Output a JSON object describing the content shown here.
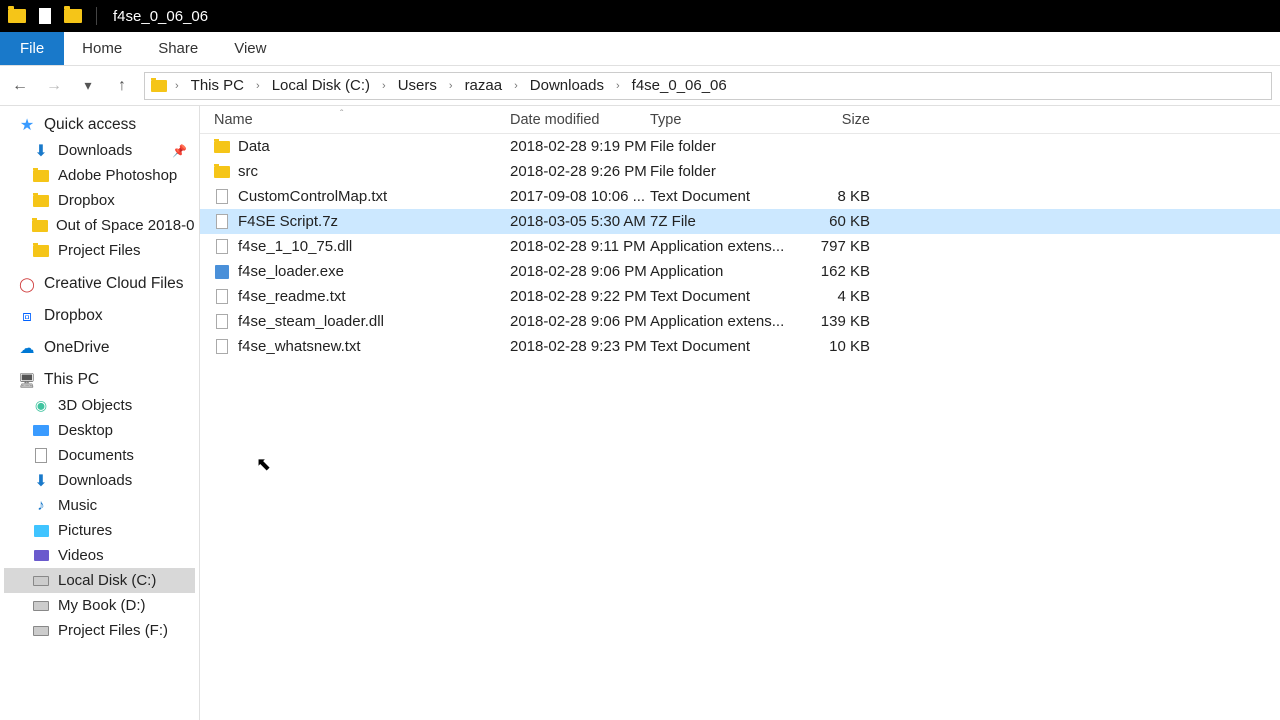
{
  "window": {
    "title": "f4se_0_06_06"
  },
  "ribbon": {
    "file": "File",
    "tabs": [
      "Home",
      "Share",
      "View"
    ]
  },
  "breadcrumb": [
    "This PC",
    "Local Disk (C:)",
    "Users",
    "razaa",
    "Downloads",
    "f4se_0_06_06"
  ],
  "columns": {
    "name": "Name",
    "date": "Date modified",
    "type": "Type",
    "size": "Size"
  },
  "sidebar": {
    "quick_access": {
      "label": "Quick access"
    },
    "quick_items": [
      {
        "label": "Downloads",
        "icon": "down",
        "pinned": true
      },
      {
        "label": "Adobe Photoshop",
        "icon": "folder"
      },
      {
        "label": "Dropbox",
        "icon": "folder"
      },
      {
        "label": "Out of Space 2018-0",
        "icon": "folder"
      },
      {
        "label": "Project Files",
        "icon": "folder"
      }
    ],
    "roots": [
      {
        "label": "Creative Cloud Files",
        "icon": "cc"
      },
      {
        "label": "Dropbox",
        "icon": "dropbox"
      },
      {
        "label": "OneDrive",
        "icon": "onedrive"
      },
      {
        "label": "This PC",
        "icon": "pc"
      }
    ],
    "thispc": [
      {
        "label": "3D Objects",
        "icon": "3d"
      },
      {
        "label": "Desktop",
        "icon": "desktop"
      },
      {
        "label": "Documents",
        "icon": "doc"
      },
      {
        "label": "Downloads",
        "icon": "down"
      },
      {
        "label": "Music",
        "icon": "music"
      },
      {
        "label": "Pictures",
        "icon": "pic"
      },
      {
        "label": "Videos",
        "icon": "vid"
      },
      {
        "label": "Local Disk (C:)",
        "icon": "disk",
        "selected": true
      },
      {
        "label": "My Book (D:)",
        "icon": "disk"
      },
      {
        "label": "Project Files (F:)",
        "icon": "disk"
      }
    ]
  },
  "files": [
    {
      "name": "Data",
      "date": "2018-02-28 9:19 PM",
      "type": "File folder",
      "size": "",
      "icon": "folder"
    },
    {
      "name": "src",
      "date": "2018-02-28 9:26 PM",
      "type": "File folder",
      "size": "",
      "icon": "folder"
    },
    {
      "name": "CustomControlMap.txt",
      "date": "2017-09-08 10:06 ...",
      "type": "Text Document",
      "size": "8 KB",
      "icon": "file"
    },
    {
      "name": "F4SE Script.7z",
      "date": "2018-03-05 5:30 AM",
      "type": "7Z File",
      "size": "60 KB",
      "icon": "file",
      "selected": true
    },
    {
      "name": "f4se_1_10_75.dll",
      "date": "2018-02-28 9:11 PM",
      "type": "Application extens...",
      "size": "797 KB",
      "icon": "file"
    },
    {
      "name": "f4se_loader.exe",
      "date": "2018-02-28 9:06 PM",
      "type": "Application",
      "size": "162 KB",
      "icon": "exe"
    },
    {
      "name": "f4se_readme.txt",
      "date": "2018-02-28 9:22 PM",
      "type": "Text Document",
      "size": "4 KB",
      "icon": "file"
    },
    {
      "name": "f4se_steam_loader.dll",
      "date": "2018-02-28 9:06 PM",
      "type": "Application extens...",
      "size": "139 KB",
      "icon": "file"
    },
    {
      "name": "f4se_whatsnew.txt",
      "date": "2018-02-28 9:23 PM",
      "type": "Text Document",
      "size": "10 KB",
      "icon": "file"
    }
  ]
}
